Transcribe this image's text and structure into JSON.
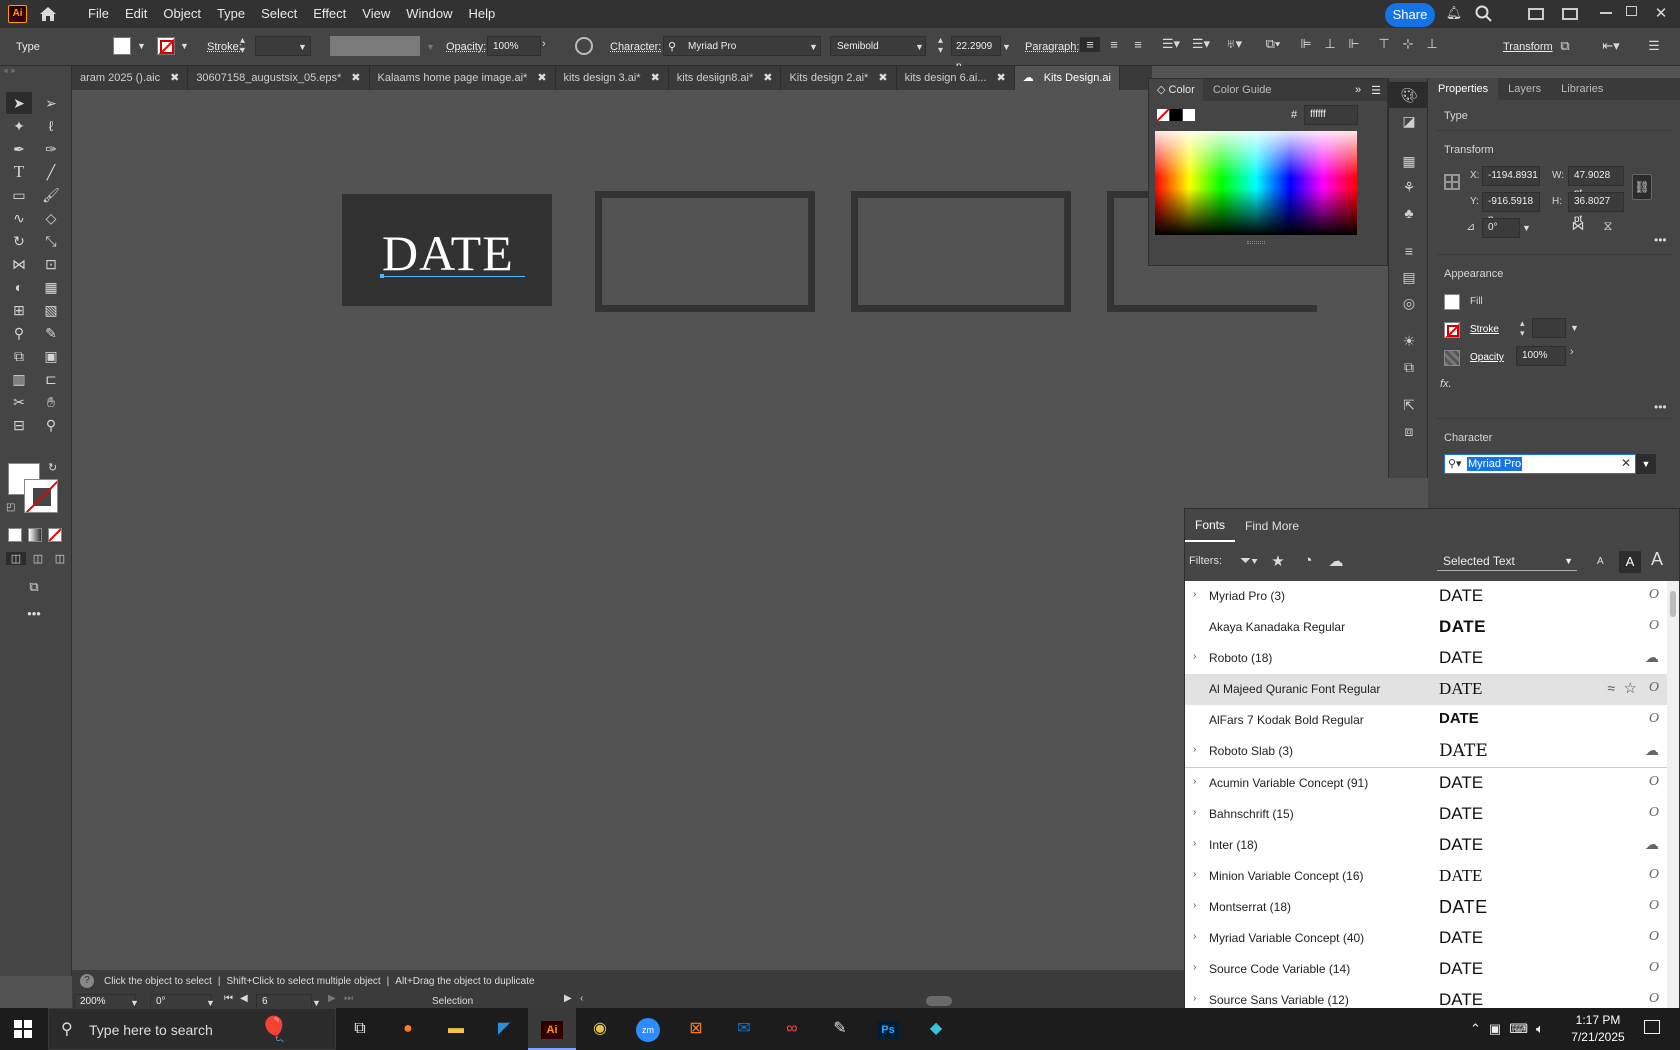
{
  "menubar": {
    "logo": "Ai",
    "items": [
      "File",
      "Edit",
      "Object",
      "Type",
      "Select",
      "Effect",
      "View",
      "Window",
      "Help"
    ],
    "share_label": "Share"
  },
  "controlbar": {
    "selection_label": "Type",
    "stroke_label": "Stroke:",
    "opacity_label": "Opacity:",
    "opacity_value": "100%",
    "character_label": "Character:",
    "font_family": "Myriad Pro",
    "font_style": "Semibold",
    "font_size": "22.2909 p",
    "paragraph_label": "Paragraph:",
    "transform_label": "Transform"
  },
  "tabs": [
    {
      "label": "aram 2025 ().aic",
      "active": false
    },
    {
      "label": "30607158_augustsix_05.eps*",
      "active": false
    },
    {
      "label": "Kalaams home page image.ai*",
      "active": false
    },
    {
      "label": "kits design 3.ai*",
      "active": false
    },
    {
      "label": "kits desiign8.ai*",
      "active": false
    },
    {
      "label": "Kits design 2.ai*",
      "active": false
    },
    {
      "label": "kits design 6.ai...",
      "active": false
    },
    {
      "label": "Kits Design.ai",
      "active": true
    }
  ],
  "canvas": {
    "artboard_text": "DATE"
  },
  "color_panel": {
    "tab_color": "Color",
    "tab_guide": "Color Guide",
    "hex_label": "#",
    "hex_value": "ffffff"
  },
  "properties": {
    "tabs": [
      "Properties",
      "Layers",
      "Libraries"
    ],
    "type_label": "Type",
    "transform_title": "Transform",
    "x_label": "X:",
    "x_value": "-1194.8931",
    "y_label": "Y:",
    "y_value": "-916.5918 p",
    "w_label": "W:",
    "w_value": "47.9028 pt",
    "h_label": "H:",
    "h_value": "36.8027 pt",
    "rotate_value": "0°",
    "appearance_title": "Appearance",
    "fill_label": "Fill",
    "stroke_label": "Stroke",
    "opacity_label": "Opacity",
    "opacity_value": "100%",
    "fx_label": "fx.",
    "character_title": "Character",
    "font_search_value": "Myriad Pro"
  },
  "fonts_panel": {
    "tabs": [
      "Fonts",
      "Find More"
    ],
    "filters_label": "Filters:",
    "preview_select": "Selected Text",
    "size_small": "A",
    "size_mid": "A",
    "size_large": "A",
    "rows": [
      {
        "name": "Myriad Pro (3)",
        "preview": "DATE",
        "expand": "›",
        "status": "O"
      },
      {
        "name": "Akaya Kanadaka Regular",
        "preview": "DATE",
        "expand": "",
        "status": "O"
      },
      {
        "name": "Roboto (18)",
        "preview": "DATE",
        "expand": "›",
        "status": "☁"
      },
      {
        "name": "Al Majeed Quranic Font Regular",
        "preview": "DATE",
        "expand": "",
        "status": "O"
      },
      {
        "name": "AlFars 7 Kodak Bold Regular",
        "preview": "DATE",
        "expand": "",
        "status": "O"
      },
      {
        "name": "Roboto Slab (3)",
        "preview": "DATE",
        "expand": "›",
        "status": "☁"
      },
      {
        "name": "Acumin Variable Concept (91)",
        "preview": "DATE",
        "expand": "›",
        "status": "O"
      },
      {
        "name": "Bahnschrift (15)",
        "preview": "DATE",
        "expand": "›",
        "status": "O"
      },
      {
        "name": "Inter (18)",
        "preview": "DATE",
        "expand": "›",
        "status": "☁"
      },
      {
        "name": "Minion Variable Concept (16)",
        "preview": "DATE",
        "expand": "›",
        "status": "O"
      },
      {
        "name": "Montserrat (18)",
        "preview": "DATE",
        "expand": "›",
        "status": "O"
      },
      {
        "name": "Myriad Variable Concept (40)",
        "preview": "DATE",
        "expand": "›",
        "status": "O"
      },
      {
        "name": "Source Code Variable (14)",
        "preview": "DATE",
        "expand": "›",
        "status": "O"
      },
      {
        "name": "Source Sans Variable (12)",
        "preview": "DATE",
        "expand": "›",
        "status": "O"
      }
    ]
  },
  "statusbar": {
    "hint_1": "Click the object to select",
    "hint_2": "Shift+Click to select multiple object",
    "hint_3": "Alt+Drag the object to duplicate",
    "zoom": "200%",
    "rotation": "0°",
    "artboard_num": "6",
    "tool_name": "Selection"
  },
  "taskbar": {
    "search_placeholder": "Type here to search",
    "time": "1:17 PM",
    "date": "7/21/2025"
  }
}
